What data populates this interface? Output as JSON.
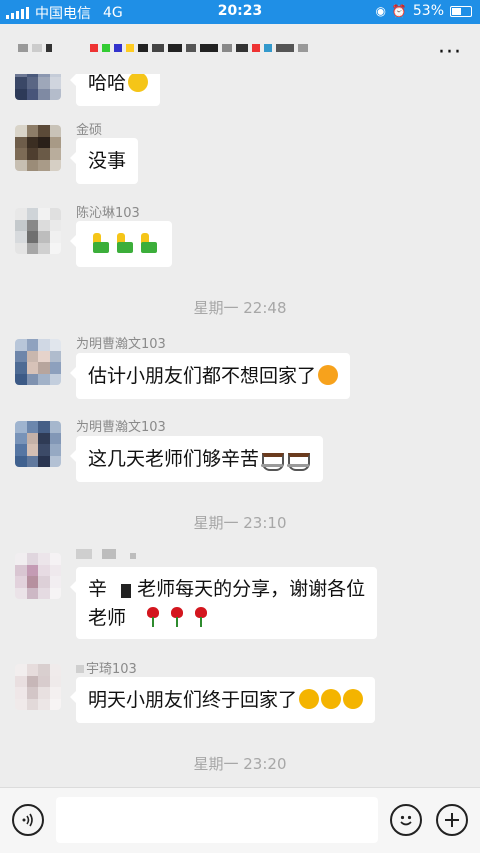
{
  "status_bar": {
    "carrier": "中国电信",
    "network": "4G",
    "time": "20:23",
    "battery": "53%",
    "battery_level": 0.53
  },
  "header": {
    "more_label": "···"
  },
  "messages": [
    {
      "sender": "",
      "text": "哈哈",
      "emoji": "grin"
    },
    {
      "sender": "金硕",
      "text": "没事"
    },
    {
      "sender": "陈沁琳103",
      "text": ""
    },
    {
      "sender": "为明曹瀚文103",
      "text": "估计小朋友们都不想回家了"
    },
    {
      "sender": "为明曹瀚文103",
      "text": "这几天老师们够辛苦"
    },
    {
      "sender": "",
      "line1_a": "辛",
      "line1_b": "老师每天的分享，谢谢各位",
      "line2": "老师"
    },
    {
      "sender": "宇琦103",
      "text": "明天小朋友们终于回家了"
    }
  ],
  "timestamps": [
    "星期一 22:48",
    "星期一 23:10",
    "星期一 23:20"
  ],
  "input": {
    "placeholder": ""
  },
  "icons": {
    "voice": "voice-icon",
    "emoji": "emoji-icon",
    "plus": "plus-icon",
    "more": "more-icon"
  },
  "colors": {
    "status_bar": "#1f8fe6",
    "background": "#ededed",
    "bubble": "#ffffff"
  }
}
